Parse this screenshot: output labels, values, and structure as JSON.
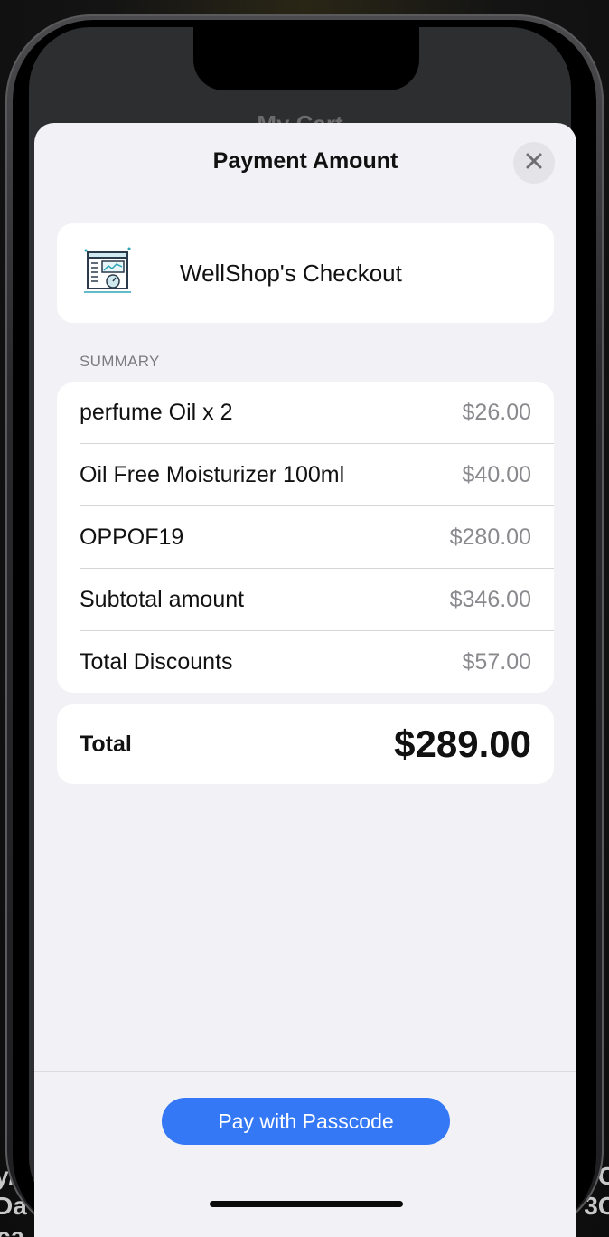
{
  "background": {
    "app_title": "My Cart",
    "left_fragments": [
      "y/",
      "Da",
      "ca"
    ],
    "right_fragments": [
      "C",
      "3C"
    ]
  },
  "sheet": {
    "title": "Payment Amount",
    "close_icon": "xmark-icon"
  },
  "merchant": {
    "logo_icon": "dashboard-report-icon",
    "name": "WellShop's Checkout"
  },
  "summary": {
    "section_label": "SUMMARY",
    "items": [
      {
        "label": "perfume Oil x 2",
        "value": "$26.00"
      },
      {
        "label": "Oil Free Moisturizer 100ml",
        "value": "$40.00"
      },
      {
        "label": "OPPOF19",
        "value": "$280.00"
      },
      {
        "label": "Subtotal amount",
        "value": "$346.00"
      },
      {
        "label": "Total Discounts",
        "value": "$57.00"
      }
    ]
  },
  "total": {
    "label": "Total",
    "value": "$289.00"
  },
  "action": {
    "pay_label": "Pay with Passcode",
    "accent_color": "#3478f6"
  }
}
